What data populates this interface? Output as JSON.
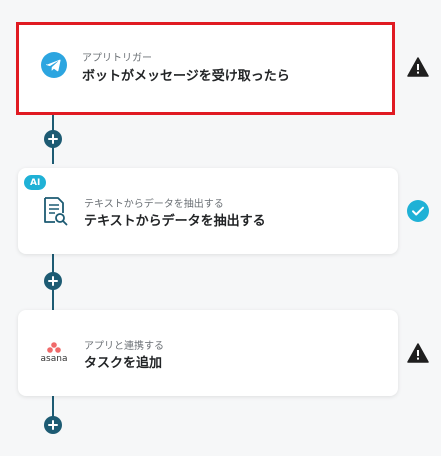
{
  "flow": {
    "steps": [
      {
        "sub_label": "アプリトリガー",
        "title": "ボットがメッセージを受け取ったら",
        "icon": "telegram-icon",
        "status": "warning"
      },
      {
        "badge": "AI",
        "sub_label": "テキストからデータを抽出する",
        "title": "テキストからデータを抽出する",
        "icon": "document-search-icon",
        "status": "success"
      },
      {
        "sub_label": "アプリと連携する",
        "title": "タスクを追加",
        "icon": "asana-icon",
        "icon_text": "asana",
        "status": "warning"
      }
    ]
  },
  "colors": {
    "accent": "#1d5b73",
    "selected_border": "#e01a22",
    "success": "#1fb1d6",
    "telegram": "#2ca5e0",
    "asana": "#f06a6a"
  }
}
